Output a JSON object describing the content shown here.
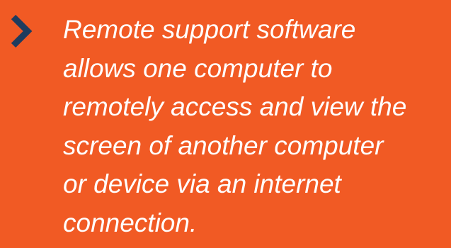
{
  "colors": {
    "background": "#f15a24",
    "text": "#ffffff",
    "chevron": "#1f3c5e"
  },
  "icon": "chevron-right-icon",
  "statement": {
    "lines": [
      "Remote support software",
      "allows one computer to",
      "remotely access and view the",
      "screen of another computer",
      "or device via an internet",
      "connection."
    ]
  }
}
